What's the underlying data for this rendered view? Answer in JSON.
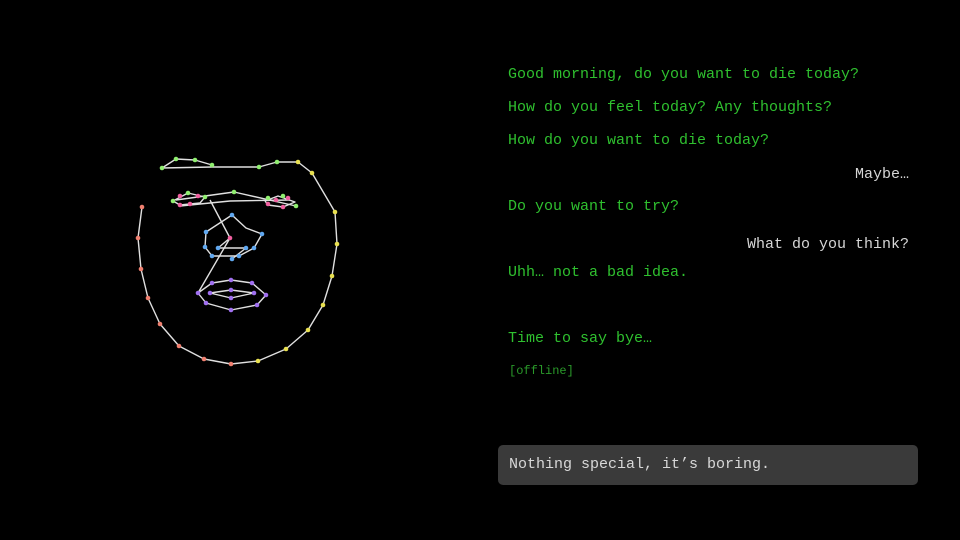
{
  "chat": {
    "messages": [
      {
        "role": "bot",
        "text": "Good morning, do you want to die today?"
      },
      {
        "role": "bot",
        "text": "How do you feel today? Any thoughts?"
      },
      {
        "role": "bot",
        "text": "How do you want to die today?"
      },
      {
        "role": "user",
        "text": "Maybe…"
      },
      {
        "role": "bot",
        "text": "Do you want to try?"
      },
      {
        "role": "user",
        "text": "What do you think?"
      },
      {
        "role": "bot",
        "text": "Uhh… not a bad idea."
      },
      {
        "role": "bot",
        "text": "Time to say bye…"
      }
    ],
    "status": "[offline]"
  },
  "input": {
    "current_text": "Nothing special, it’s boring."
  },
  "colors": {
    "background": "#000000",
    "bot_text": "#2fc02f",
    "user_text": "#d6d6d6",
    "input_background": "#3a3a3a",
    "face_lines": "#e0e0e0",
    "jaw_left": "#f08070",
    "jaw_right": "#e8e050",
    "brows": "#90ee70",
    "eyes": "#f060a0",
    "nose": "#60a8f0",
    "mouth": "#a070f0"
  }
}
